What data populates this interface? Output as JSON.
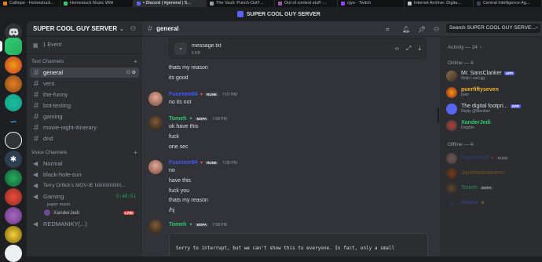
{
  "browser_tabs": [
    {
      "label": "Calliope - Homestuck..."
    },
    {
      "label": "Homestuck Music Wiki"
    },
    {
      "label": "• Discord | #general | S..."
    },
    {
      "label": "The Vault: Punch-Out!!..."
    },
    {
      "label": "Out of context stuff -..."
    },
    {
      "label": "cjya - Twitch"
    },
    {
      "label": "Internet Archive: Digita..."
    },
    {
      "label": "Central Intelligence Ag..."
    }
  ],
  "window_title": "SUPER COOL GUY SERVER",
  "server": {
    "name": "SUPER COOL GUY SERVER",
    "events": "1 Event"
  },
  "sidebar": {
    "text_category": "Text Channels",
    "text_channels": [
      "general",
      "vent",
      "the-funny",
      "bot-testing",
      "gaming",
      "movie-night-itinerary",
      "dnd"
    ],
    "voice_category": "Voice Channels",
    "voice_channels": [
      "Normal",
      "black-hole-sun",
      "Terry Orflick's MOV-IE NIIIIIIIIIIIIIIII...",
      "Gaming"
    ],
    "gaming_meta": "paper mario",
    "gaming_timer": "5:40:51",
    "gaming_user": "XanderJedi",
    "live_label": "LIVE",
    "next_channel": "REDMANIKY(...)"
  },
  "channel": {
    "name": "general",
    "search_placeholder": "Search SUPER COOL GUY SERVE..."
  },
  "attachment": {
    "filename": "message.txt",
    "size": "5 KB"
  },
  "messages": {
    "line1": "thats my reason",
    "line2": "its good",
    "m1_user": "Fusenen94",
    "m1_tag": "RUNE",
    "m1_time": "7:07 PM",
    "m1_text": "no its not",
    "m2_user": "Tomeh",
    "m2_tag": "MSPA",
    "m2_time": "7:08 PM",
    "m2_lines": [
      "ok have this",
      "fuck",
      "one sec"
    ],
    "m3_user": "Fusenen94",
    "m3_tag": "RUNE",
    "m3_time": "7:08 PM",
    "m3_lines": [
      "no",
      "have this",
      "fuck you",
      "thats my reason",
      "/hj"
    ],
    "m4_user": "Tomeh",
    "m4_tag": "MSPA",
    "m4_time": "7:08 PM",
    "system_text": "Sorry to interrupt, but we can't show this to everyone. In fact, only a small"
  },
  "members": {
    "activity": "Activity — 24",
    "online_header": "Online — 4",
    "offline_header": "Offline — 4",
    "online": [
      {
        "name": "Mr. SansClanker",
        "tag": "APP",
        "sub": "/help | carl.gg",
        "color": "#dbdee1"
      },
      {
        "name": "puerfiftyseven",
        "tag": "",
        "sub": "puer",
        "color": "#f0b232"
      },
      {
        "name": "The digital footpri...",
        "tag": "APP",
        "sub": "Reply @Mention",
        "color": "#dbdee1"
      },
      {
        "name": "XanderJedi",
        "tag": "",
        "sub": "Dolphin",
        "color": "#2dc770"
      }
    ],
    "offline": [
      {
        "name": "Fusenen94",
        "tag": "RUNE",
        "color": "#3d5afe"
      },
      {
        "name": "Jackblackolantern",
        "tag": "",
        "color": "#c27c0e"
      },
      {
        "name": "Tomeh",
        "tag": "MSPA",
        "color": "#2dc770"
      },
      {
        "name": "Wizard",
        "tag": "",
        "color": "#5865f2"
      }
    ]
  },
  "colors": {
    "fusen": "#3d5afe",
    "tomeh": "#2dc770",
    "accent": "#5865f2"
  }
}
